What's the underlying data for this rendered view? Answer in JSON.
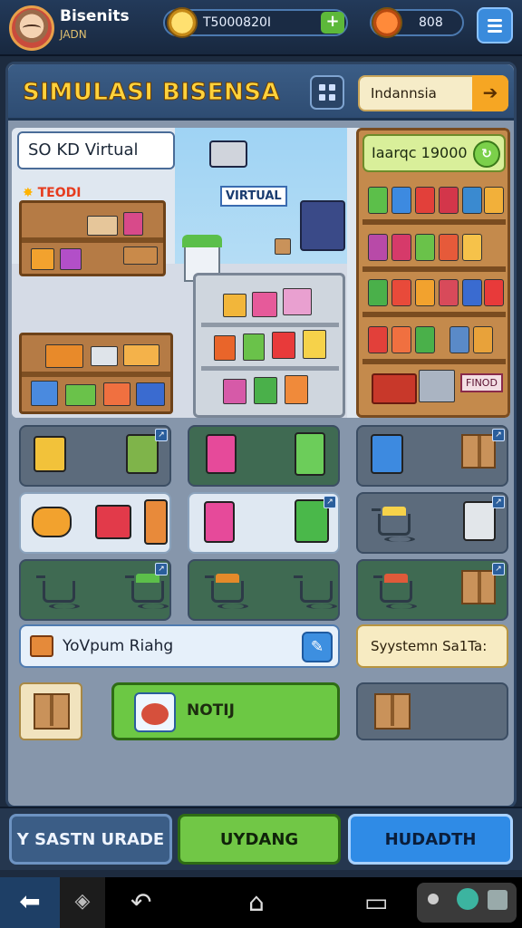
{
  "topbar": {
    "brand_name": "Bisenits",
    "brand_sub": "JADN",
    "currency_value": "T5000820I",
    "gems_value": "808",
    "plus_label": "+"
  },
  "panel": {
    "title": "SIMULASI BISENSA",
    "language_label": "Indannsia"
  },
  "scene": {
    "virtual_label": "SO KD Virtual",
    "promo_burst": "TEODI",
    "virtual_tag": "VIRTUAL",
    "rack_label": "Iaarqc 19000",
    "rack_sign": "FINOD"
  },
  "bottom": {
    "info_label": "YoVpum Riahg",
    "system_label": "Syystemn Sa1Ta:",
    "green_button_label": "NOTIJ"
  },
  "actions": {
    "left_label": "Y SASTN URADE",
    "middle_label": "UYDANG",
    "right_label": "HUDADTH"
  },
  "colors": {
    "title": "#ffd23c",
    "panel": "#8696ab",
    "green": "#6cc844",
    "blue": "#2f8be6"
  }
}
